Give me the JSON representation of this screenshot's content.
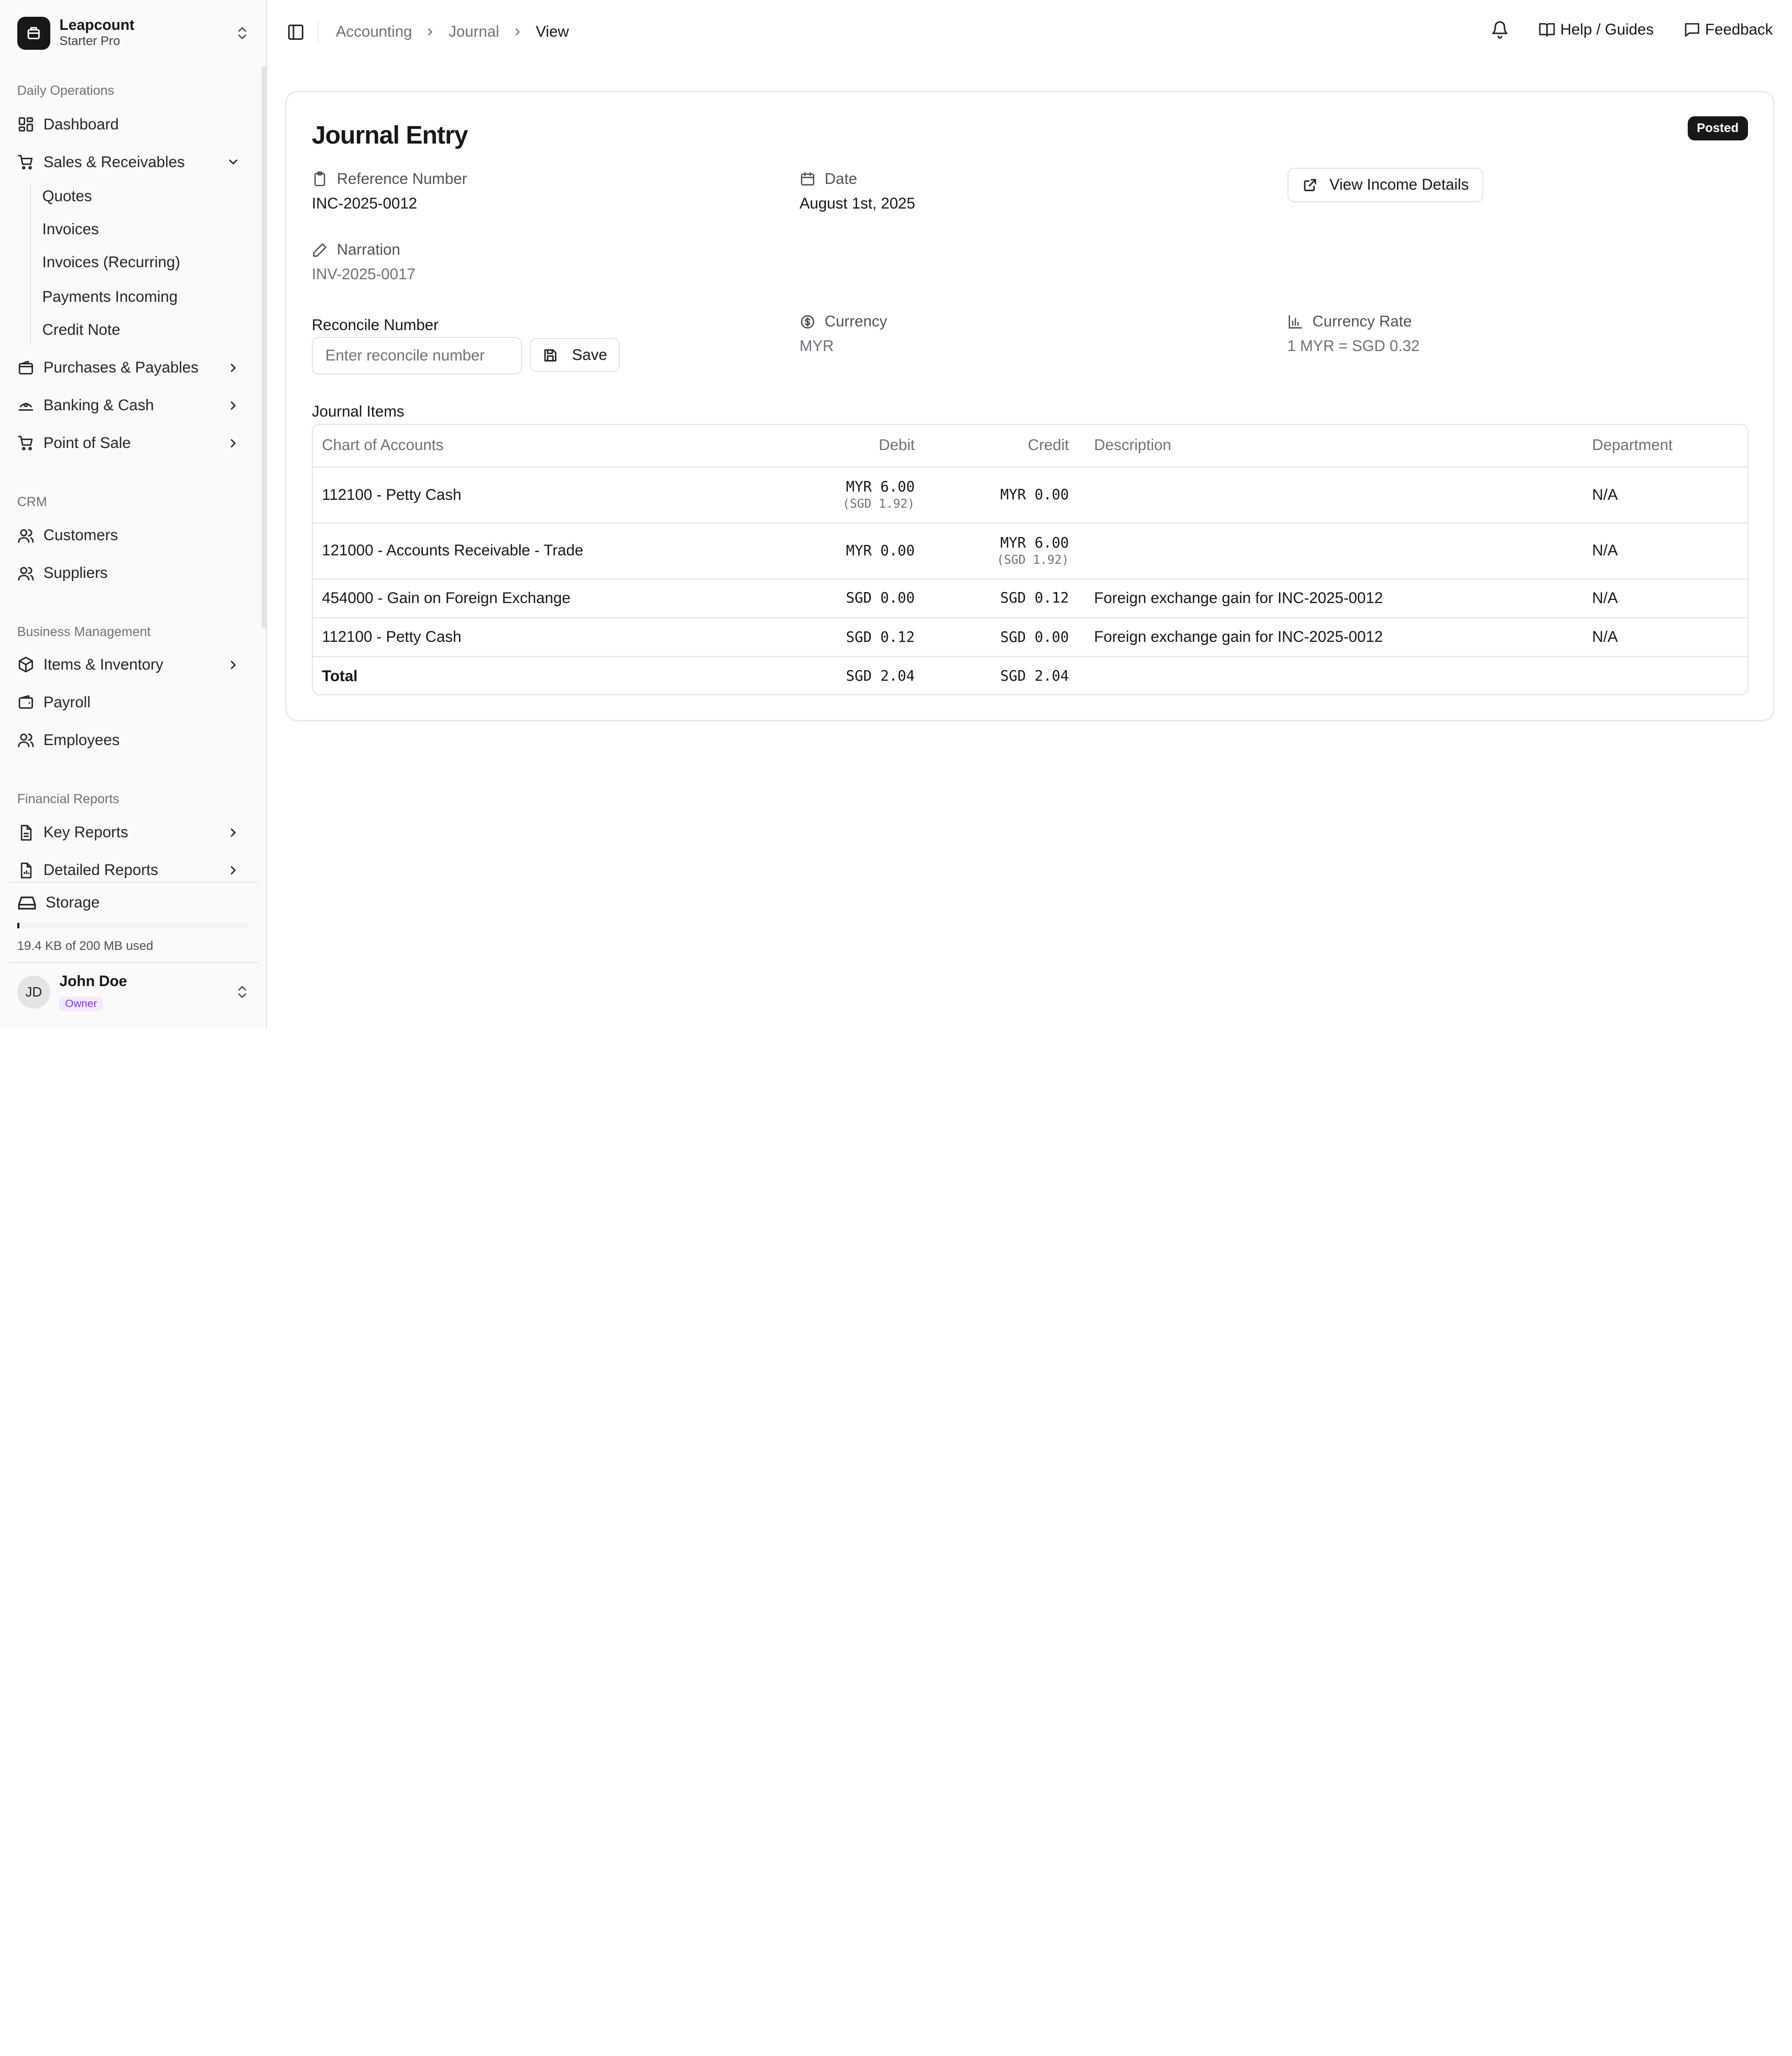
{
  "org": {
    "name": "Leapcount",
    "plan": "Starter Pro"
  },
  "sidebar": {
    "groups": {
      "daily": "Daily Operations",
      "crm": "CRM",
      "business": "Business Management",
      "reports": "Financial Reports"
    },
    "items": {
      "dashboard": "Dashboard",
      "sales": "Sales & Receivables",
      "purchases": "Purchases & Payables",
      "banking": "Banking & Cash",
      "pos": "Point of Sale",
      "customers": "Customers",
      "suppliers": "Suppliers",
      "inventory": "Items & Inventory",
      "payroll": "Payroll",
      "employees": "Employees",
      "key_reports": "Key Reports",
      "detailed_reports": "Detailed Reports"
    },
    "sales_sub": [
      "Quotes",
      "Invoices",
      "Invoices (Recurring)",
      "Payments Incoming",
      "Credit Note"
    ],
    "storage": {
      "label": "Storage",
      "usage": "19.4 KB of 200 MB used",
      "fraction": 0.0001
    }
  },
  "user": {
    "initials": "JD",
    "name": "John Doe",
    "role": "Owner"
  },
  "breadcrumb": [
    "Accounting",
    "Journal",
    "View"
  ],
  "topbar": {
    "help": "Help / Guides",
    "feedback": "Feedback"
  },
  "entry": {
    "title": "Journal Entry",
    "status": "Posted",
    "reference_label": "Reference Number",
    "reference": "INC-2025-0012",
    "date_label": "Date",
    "date": "August 1st, 2025",
    "income_button": "View Income Details",
    "narration_label": "Narration",
    "narration": "INV-2025-0017",
    "reconcile_label": "Reconcile Number",
    "reconcile_placeholder": "Enter reconcile number",
    "save_button": "Save",
    "currency_label": "Currency",
    "currency": "MYR",
    "rate_label": "Currency Rate",
    "rate": "1 MYR = SGD 0.32"
  },
  "journal": {
    "label": "Journal Items",
    "headers": [
      "Chart of Accounts",
      "Debit",
      "Credit",
      "Description",
      "Department"
    ],
    "rows": [
      {
        "account": "112100 - Petty Cash",
        "debit": "MYR 6.00",
        "debit_sub": "(SGD 1.92)",
        "credit": "MYR 0.00",
        "credit_sub": "",
        "description": "",
        "department": "N/A"
      },
      {
        "account": "121000 - Accounts Receivable - Trade",
        "debit": "MYR 0.00",
        "debit_sub": "",
        "credit": "MYR 6.00",
        "credit_sub": "(SGD 1.92)",
        "description": "",
        "department": "N/A"
      },
      {
        "account": "454000 - Gain on Foreign Exchange",
        "debit": "SGD 0.00",
        "debit_sub": "",
        "credit": "SGD 0.12",
        "credit_sub": "",
        "description": "Foreign exchange gain for INC-2025-0012",
        "department": "N/A"
      },
      {
        "account": "112100 - Petty Cash",
        "debit": "SGD 0.12",
        "debit_sub": "",
        "credit": "SGD 0.00",
        "credit_sub": "",
        "description": "Foreign exchange gain for INC-2025-0012",
        "department": "N/A"
      }
    ],
    "total": {
      "label": "Total",
      "debit": "SGD 2.04",
      "credit": "SGD 2.04"
    }
  }
}
